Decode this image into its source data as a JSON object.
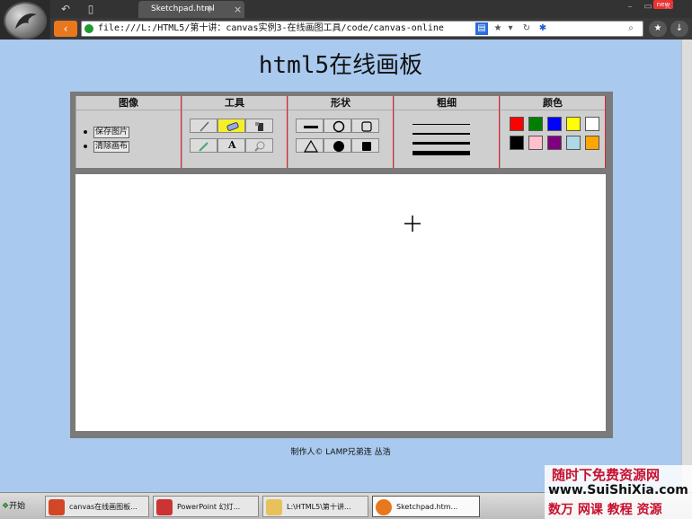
{
  "browser": {
    "tab_title": "Sketchpad.html",
    "new_badge": "new",
    "url": "file:///L:/HTML5/第十讲：canvas实例3-在线画图工具/code/canvas-online"
  },
  "page": {
    "title": "html5在线画板",
    "credit": "制作人© LAMP兄弟连 丛浩"
  },
  "toolbar": {
    "image": {
      "heading": "图像",
      "items": [
        "保存图片",
        "清除画布"
      ]
    },
    "tools": {
      "heading": "工具",
      "items": [
        {
          "icon": "pencil-icon",
          "selected": false
        },
        {
          "icon": "eraser-icon",
          "selected": true
        },
        {
          "icon": "paint-bucket-icon",
          "selected": false
        },
        {
          "icon": "eyedropper-icon",
          "selected": false
        },
        {
          "icon": "text-icon",
          "selected": false,
          "glyph": "A"
        },
        {
          "icon": "magnifier-icon",
          "selected": false
        }
      ]
    },
    "shapes": {
      "heading": "形状",
      "items": [
        "line-icon",
        "circle-icon",
        "square-icon",
        "triangle-icon",
        "filled-circle-icon",
        "filled-square-icon"
      ]
    },
    "width": {
      "heading": "粗细",
      "line_weights": [
        1,
        2,
        3,
        4
      ]
    },
    "color": {
      "heading": "颜色",
      "swatches": [
        "#ff0000",
        "#008000",
        "#0000ff",
        "#ffff00",
        "#ffffff",
        "#000000",
        "#ffc0cb",
        "#800080",
        "#add8e6",
        "#ffa500"
      ]
    }
  },
  "taskbar": {
    "start_label": "开始",
    "tasks": [
      {
        "label": "canvas在线画图板..."
      },
      {
        "label": "PowerPoint 幻灯..."
      },
      {
        "label": "L:\\HTML5\\第十讲..."
      },
      {
        "label": "Sketchpad.htm..."
      }
    ]
  },
  "watermark": {
    "line1": "随时下免费资源网",
    "line2": "www.SuiShiXia.com",
    "line3": "数万 网课 教程 资源"
  }
}
